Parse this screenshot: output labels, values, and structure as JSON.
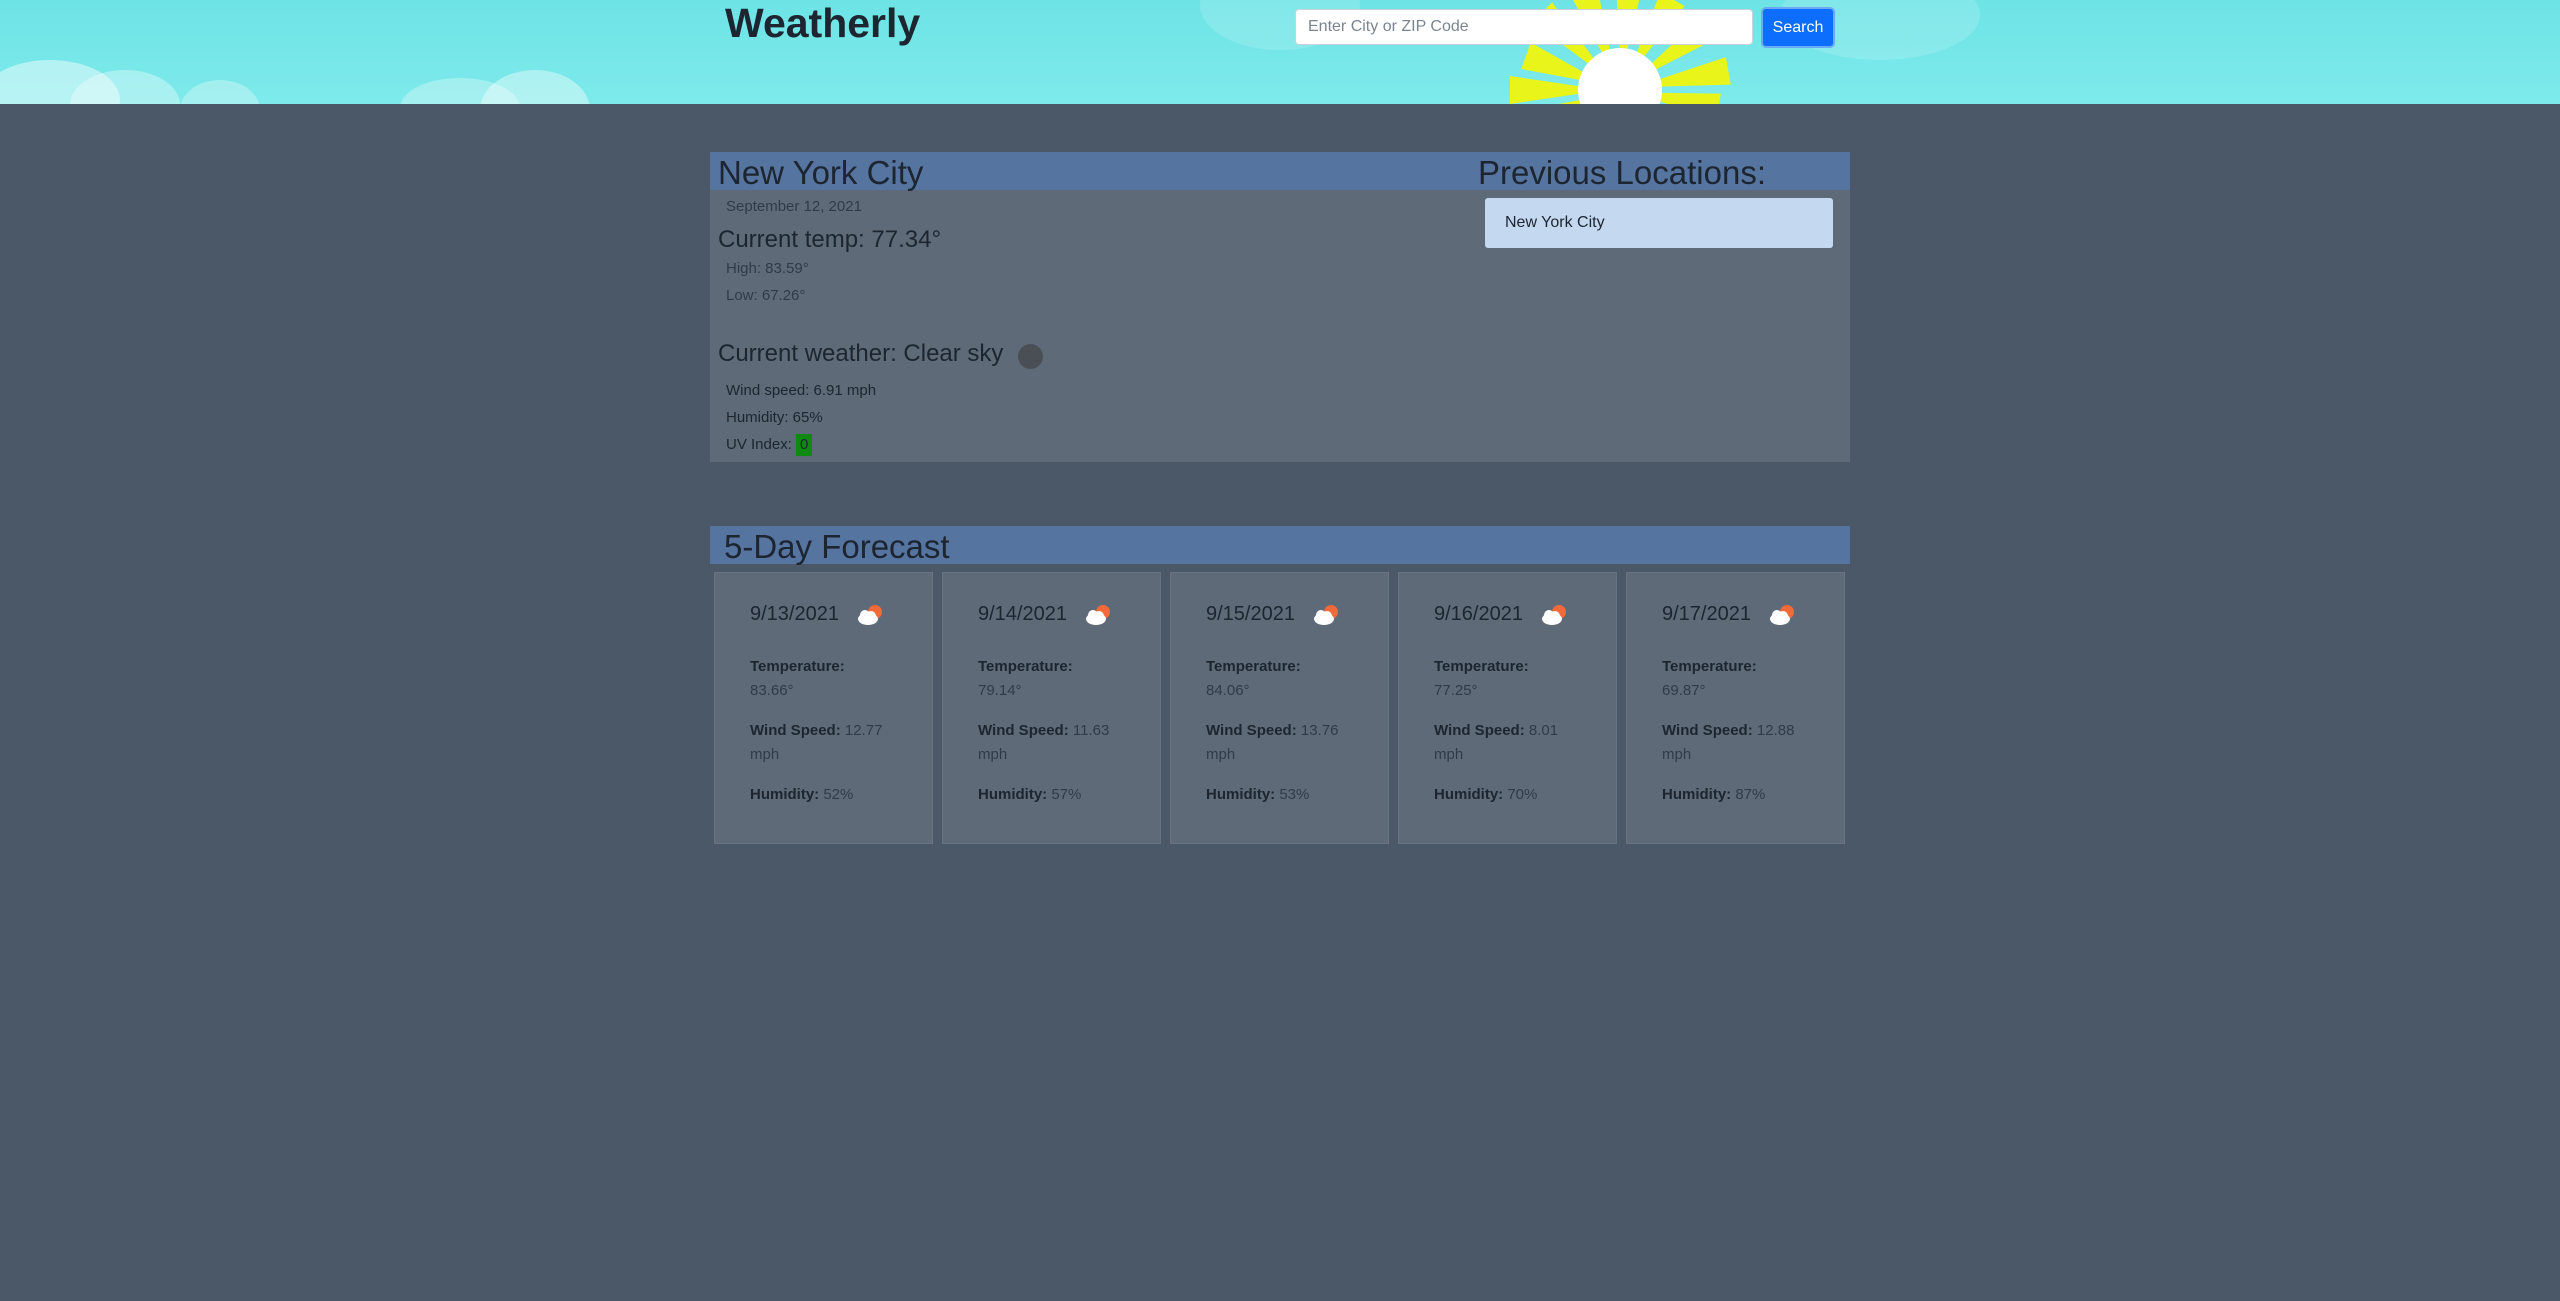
{
  "header": {
    "brand": "Weatherly",
    "search_placeholder": "Enter City or ZIP Code",
    "search_button": "Search"
  },
  "current": {
    "city": "New York City",
    "date": "September 12, 2021",
    "temp_text": "Current temp: 77.34°",
    "high_text": "High: 83.59°",
    "low_text": "Low: 67.26°",
    "weather_text": "Current weather: Clear sky",
    "wind_text": "Wind speed: 6.91 mph",
    "humidity_text": "Humidity: 65%",
    "uv_label": "UV Index:",
    "uv_value": "0",
    "uv_color": "#0e8a12"
  },
  "previous": {
    "title": "Previous Locations:",
    "items": [
      "New York City"
    ]
  },
  "forecast": {
    "title": "5-Day Forecast",
    "temp_label": "Temperature:",
    "wind_label": "Wind Speed:",
    "humidity_label": "Humidity:",
    "icon": "partly-cloudy-icon",
    "days": [
      {
        "date": "9/13/2021",
        "temp": "83.66°",
        "wind": "12.77 mph",
        "humidity": "52%"
      },
      {
        "date": "9/14/2021",
        "temp": "79.14°",
        "wind": "11.63 mph",
        "humidity": "57%"
      },
      {
        "date": "9/15/2021",
        "temp": "84.06°",
        "wind": "13.76 mph",
        "humidity": "53%"
      },
      {
        "date": "9/16/2021",
        "temp": "77.25°",
        "wind": "8.01 mph",
        "humidity": "70%"
      },
      {
        "date": "9/17/2021",
        "temp": "69.87°",
        "wind": "12.88 mph",
        "humidity": "87%"
      }
    ]
  }
}
